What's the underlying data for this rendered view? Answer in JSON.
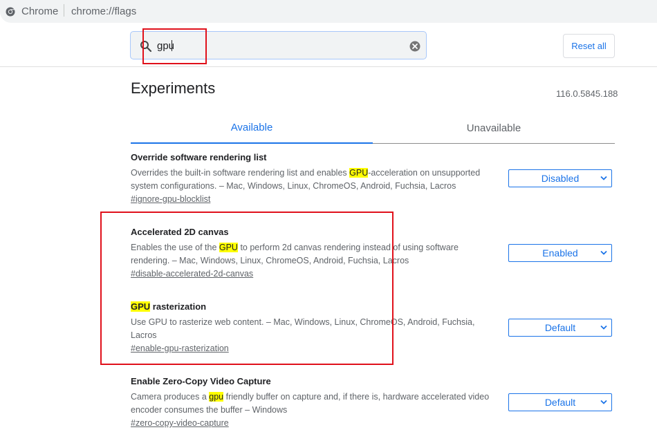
{
  "browser": {
    "site_name": "Chrome",
    "url": "chrome://flags"
  },
  "search": {
    "value": "gpu"
  },
  "header": {
    "reset_label": "Reset all"
  },
  "page": {
    "title": "Experiments",
    "version": "116.0.5845.188"
  },
  "tabs": [
    {
      "label": "Available",
      "active": true
    },
    {
      "label": "Unavailable",
      "active": false
    }
  ],
  "experiments": [
    {
      "name_parts": [
        "Override software rendering list"
      ],
      "desc_parts": [
        "Overrides the built-in software rendering list and enables ",
        "GPU",
        "-acceleration on unsupported system configurations. – Mac, Windows, Linux, ChromeOS, Android, Fuchsia, Lacros"
      ],
      "link": "#ignore-gpu-blocklist",
      "select_value": "Disabled"
    },
    {
      "name_parts": [
        "Accelerated 2D canvas"
      ],
      "desc_parts": [
        "Enables the use of the ",
        "GPU",
        " to perform 2d canvas rendering instead of using software rendering. – Mac, Windows, Linux, ChromeOS, Android, Fuchsia, Lacros"
      ],
      "link": "#disable-accelerated-2d-canvas",
      "select_value": "Enabled"
    },
    {
      "name_parts": [
        "GPU",
        " rasterization"
      ],
      "desc_parts": [
        "Use GPU to rasterize web content. – Mac, Windows, Linux, ChromeOS, Android, Fuchsia, Lacros"
      ],
      "link": "#enable-gpu-rasterization",
      "select_value": "Default"
    },
    {
      "name_parts": [
        "Enable Zero-Copy Video Capture"
      ],
      "desc_parts": [
        "Camera produces a ",
        "gpu",
        " friendly buffer on capture and, if there is, hardware accelerated video encoder consumes the buffer – Windows"
      ],
      "link": "#zero-copy-video-capture",
      "select_value": "Default"
    }
  ],
  "colors": {
    "accent": "#1a73e8",
    "highlight": "#ffff00",
    "annotation": "#e0101a"
  }
}
